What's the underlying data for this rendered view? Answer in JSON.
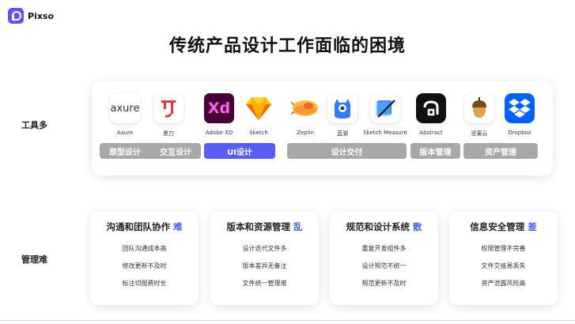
{
  "brand": {
    "name": "Pixso",
    "logo_icon": "pixso-logo-icon",
    "color": "#6d4df2"
  },
  "title": "传统产品设计工作面临的困境",
  "rows": {
    "tools_label": "工具多",
    "issues_label": "管理难"
  },
  "tools": [
    {
      "id": "axure",
      "label": "Axure",
      "icon_text": "axure",
      "icon": "axure-icon"
    },
    {
      "id": "modao",
      "label": "墨刀",
      "icon_text": "",
      "icon": "modao-icon"
    },
    {
      "id": "adobexd",
      "label": "Adobe XD",
      "icon_text": "Xd",
      "icon": "adobe-xd-icon"
    },
    {
      "id": "sketch",
      "label": "Sketch",
      "icon_text": "",
      "icon": "sketch-diamond-icon"
    },
    {
      "id": "zeplin",
      "label": "Zeplin",
      "icon_text": "",
      "icon": "zeplin-icon"
    },
    {
      "id": "lanhu",
      "label": "蓝湖",
      "icon_text": "",
      "icon": "lanhu-icon"
    },
    {
      "id": "sketchmeasure",
      "label": "Sketch Measure",
      "icon_text": "",
      "icon": "sketch-measure-icon"
    },
    {
      "id": "abstract",
      "label": "Abstract",
      "icon_text": "",
      "icon": "abstract-icon"
    },
    {
      "id": "jianguoyun",
      "label": "坚果云",
      "icon_text": "",
      "icon": "jianguoyun-icon"
    },
    {
      "id": "dropbox",
      "label": "Dropbox",
      "icon_text": "",
      "icon": "dropbox-icon"
    }
  ],
  "categories": {
    "prototype": "原型设计",
    "interaction": "交互设计",
    "ui": "UI设计",
    "handoff": "设计交付",
    "version": "版本管理",
    "asset": "资产管理"
  },
  "issues": [
    {
      "title": "沟通和团队协作",
      "accent": "难",
      "items": [
        "团队沟通成本高",
        "修改更新不及时",
        "标注切图费时长"
      ]
    },
    {
      "title": "版本和资源管理",
      "accent": "乱",
      "items": [
        "设计迭代文件多",
        "版本差异无备注",
        "文件统一管理难"
      ]
    },
    {
      "title": "规范和设计系统",
      "accent": "散",
      "items": [
        "重复开发组件多",
        "设计规范不统一",
        "规范更新不及时"
      ]
    },
    {
      "title": "信息安全管理",
      "accent": "差",
      "items": [
        "权限管理不完善",
        "文件交接易丢失",
        "资产泄露风险高"
      ]
    }
  ],
  "colors": {
    "accent": "#3b63f5",
    "ui_category": "#5a5df5",
    "category": "#a8a8a8"
  }
}
